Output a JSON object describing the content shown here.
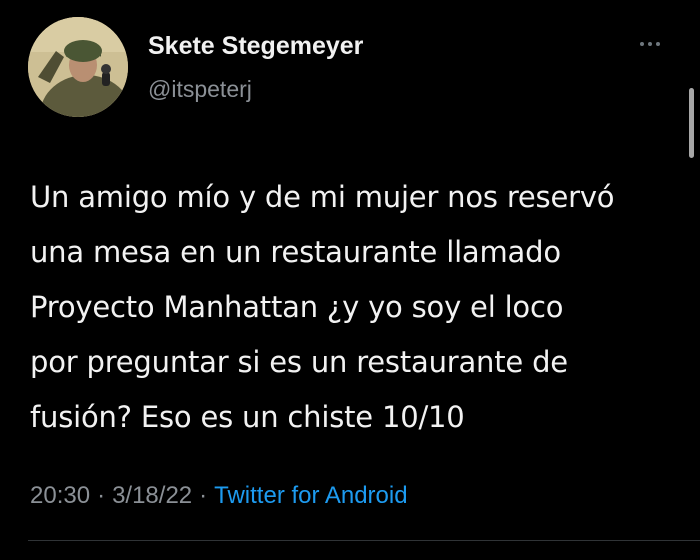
{
  "user": {
    "display_name": "Skete Stegemeyer",
    "handle": "@itspeterj"
  },
  "tweet": {
    "text_lines": [
      "Un amigo mío y de mi mujer nos reservó",
      "una mesa en un restaurante llamado",
      "Proyecto Manhattan ¿y yo soy el loco",
      "por preguntar si es un restaurante de",
      "fusión? Eso es un chiste 10/10"
    ],
    "time": "20:30",
    "date": "3/18/22",
    "source": "Twitter for Android",
    "separator": "·"
  },
  "icons": {
    "more": "more-options-icon",
    "avatar": "profile-avatar"
  },
  "colors": {
    "background": "#000000",
    "text": "#e7e9ea",
    "secondary": "#8b9096",
    "link": "#1d9bf0"
  }
}
